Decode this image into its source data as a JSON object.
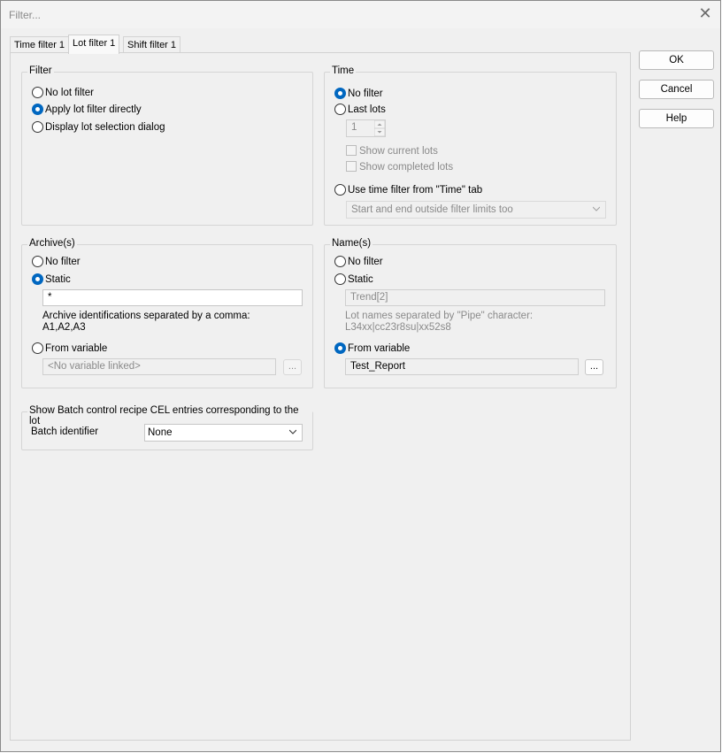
{
  "window": {
    "title": "Filter...",
    "close_glyph": "✕"
  },
  "tabs": [
    {
      "label": "Time filter 1"
    },
    {
      "label": "Lot filter 1"
    },
    {
      "label": "Shift filter 1"
    }
  ],
  "buttons": {
    "ok": "OK",
    "cancel": "Cancel",
    "help": "Help"
  },
  "filter_group": {
    "label": "Filter",
    "options": [
      "No lot filter",
      "Apply lot filter directly",
      "Display lot selection dialog"
    ],
    "selected_index": 1
  },
  "time_group": {
    "label": "Time",
    "no_filter": "No filter",
    "last_lots": "Last lots",
    "last_lots_value": "1",
    "show_current": "Show current lots",
    "show_completed": "Show completed lots",
    "use_time_filter": "Use time filter from \"Time\" tab",
    "time_mode": "Start and end outside filter limits too"
  },
  "archive_group": {
    "label": "Archive(s)",
    "no_filter": "No filter",
    "static": "Static",
    "static_value": "*",
    "hint_line1": "Archive identifications separated by a comma:",
    "hint_line2": "A1,A2,A3",
    "from_variable": "From variable",
    "variable_placeholder": "<No variable linked>",
    "dots": "..."
  },
  "names_group": {
    "label": "Name(s)",
    "no_filter": "No filter",
    "static": "Static",
    "static_value": "Trend[2]",
    "hint_line1": "Lot names separated by \"Pipe\" character:",
    "hint_line2": "L34xx|cc23r8su|xx52s8",
    "from_variable": "From variable",
    "variable_value": "Test_Report",
    "dots": "..."
  },
  "batch_group": {
    "label": "Show Batch control recipe CEL entries corresponding to the lot",
    "identifier_label": "Batch identifier",
    "identifier_value": "None"
  },
  "colors": {
    "accent": "#0067c0",
    "background": "#f0f0f0"
  }
}
